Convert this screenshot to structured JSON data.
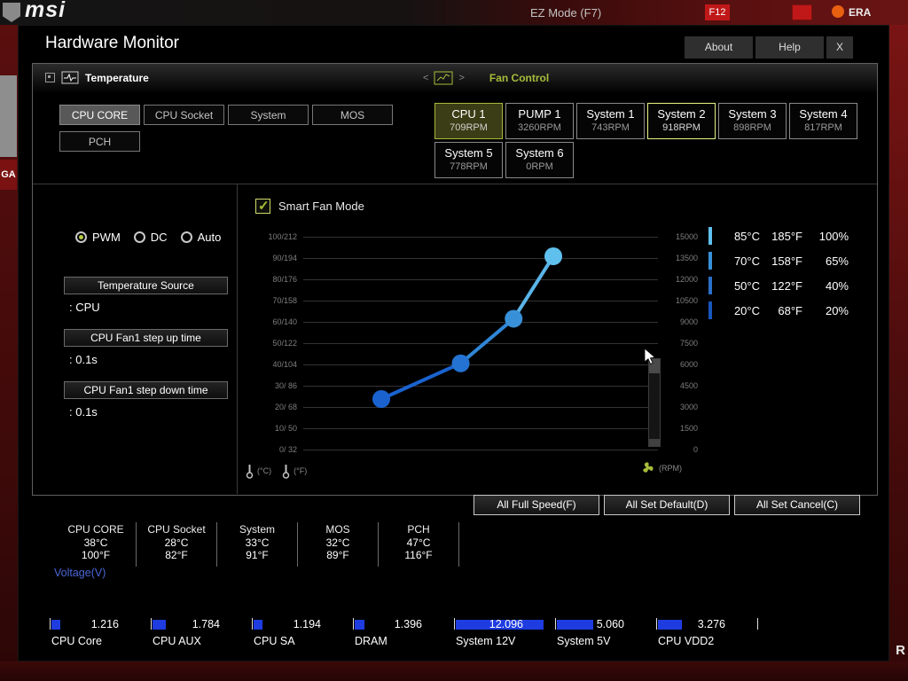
{
  "background": {
    "logo": "msi",
    "ez_mode": "EZ Mode (F7)",
    "f12": "F12",
    "lang": "ERA",
    "side_left": "GA",
    "side_right": "R"
  },
  "modal": {
    "title": "Hardware Monitor",
    "about_label": "About",
    "help_label": "Help",
    "close_label": "X"
  },
  "temperature_section": {
    "title": "Temperature",
    "tabs": [
      "CPU CORE",
      "CPU Socket",
      "System",
      "MOS",
      "PCH"
    ],
    "selected_tab": "CPU CORE"
  },
  "fan_section": {
    "title": "Fan Control",
    "fans": [
      {
        "name": "CPU 1",
        "rpm": "709RPM",
        "state": "selected"
      },
      {
        "name": "PUMP 1",
        "rpm": "3260RPM",
        "state": "normal"
      },
      {
        "name": "System 1",
        "rpm": "743RPM",
        "state": "normal"
      },
      {
        "name": "System 2",
        "rpm": "918RPM",
        "state": "highlighted"
      },
      {
        "name": "System 3",
        "rpm": "898RPM",
        "state": "normal"
      },
      {
        "name": "System 4",
        "rpm": "817RPM",
        "state": "normal"
      },
      {
        "name": "System 5",
        "rpm": "778RPM",
        "state": "normal"
      },
      {
        "name": "System 6",
        "rpm": "0RPM",
        "state": "normal"
      }
    ]
  },
  "control_panel": {
    "modes": [
      "PWM",
      "DC",
      "Auto"
    ],
    "selected_mode": "PWM",
    "settings": [
      {
        "label": "Temperature Source",
        "value": ": CPU"
      },
      {
        "label": "CPU Fan1 step up time",
        "value": ": 0.1s"
      },
      {
        "label": "CPU Fan1 step down time",
        "value": ": 0.1s"
      }
    ]
  },
  "chart_data": {
    "type": "line",
    "title": "Smart Fan Mode",
    "smart_fan_checked": true,
    "left_axis_ticks": [
      "100/212",
      "90/194",
      "80/176",
      "70/158",
      "60/140",
      "50/122",
      "40/104",
      "30/ 86",
      "20/ 68",
      "10/ 50",
      "0/ 32"
    ],
    "right_axis_ticks": [
      "15000",
      "13500",
      "12000",
      "10500",
      "9000",
      "7500",
      "6000",
      "4500",
      "3000",
      "1500",
      "0"
    ],
    "x_unit_c": "(°C)",
    "x_unit_f": "(°F)",
    "right_unit": "(RPM)",
    "points": [
      {
        "temp_c": 20,
        "duty_pct": 20
      },
      {
        "temp_c": 50,
        "duty_pct": 40
      },
      {
        "temp_c": 70,
        "duty_pct": 65
      },
      {
        "temp_c": 85,
        "duty_pct": 100
      }
    ],
    "legend": [
      {
        "celsius": "85°C",
        "fahrenheit": "185°F",
        "duty": "100%"
      },
      {
        "celsius": "70°C",
        "fahrenheit": "158°F",
        "duty": "65%"
      },
      {
        "celsius": "50°C",
        "fahrenheit": "122°F",
        "duty": "40%"
      },
      {
        "celsius": "20°C",
        "fahrenheit": "68°F",
        "duty": "20%"
      }
    ],
    "colors": {
      "segments": [
        "#1a63cf",
        "#2f86d6",
        "#5ab4e8"
      ],
      "points": [
        "#1a63cf",
        "#2473d2",
        "#3890d8",
        "#5fc0ee"
      ],
      "legend_bars": [
        "#5fc0ee",
        "#3890d8",
        "#2b6fc8",
        "#1956bc"
      ],
      "grid": "#333333"
    }
  },
  "actions": [
    "All Full Speed(F)",
    "All Set Default(D)",
    "All Set Cancel(C)"
  ],
  "temperatures": [
    {
      "name": "CPU CORE",
      "celsius": "38°C",
      "fahrenheit": "100°F"
    },
    {
      "name": "CPU Socket",
      "celsius": "28°C",
      "fahrenheit": "82°F"
    },
    {
      "name": "System",
      "celsius": "33°C",
      "fahrenheit": "91°F"
    },
    {
      "name": "MOS",
      "celsius": "32°C",
      "fahrenheit": "89°F"
    },
    {
      "name": "PCH",
      "celsius": "47°C",
      "fahrenheit": "116°F"
    }
  ],
  "voltage": {
    "title": "Voltage(V)",
    "bar_color": "#1e3ce0",
    "items": [
      {
        "name": "CPU Core",
        "value": "1.216",
        "volts": 1.216
      },
      {
        "name": "CPU AUX",
        "value": "1.784",
        "volts": 1.784
      },
      {
        "name": "CPU SA",
        "value": "1.194",
        "volts": 1.194
      },
      {
        "name": "DRAM",
        "value": "1.396",
        "volts": 1.396
      },
      {
        "name": "System 12V",
        "value": "12.096",
        "volts": 12.096
      },
      {
        "name": "System 5V",
        "value": "5.060",
        "volts": 5.06
      },
      {
        "name": "CPU VDD2",
        "value": "3.276",
        "volts": 3.276
      }
    ]
  }
}
